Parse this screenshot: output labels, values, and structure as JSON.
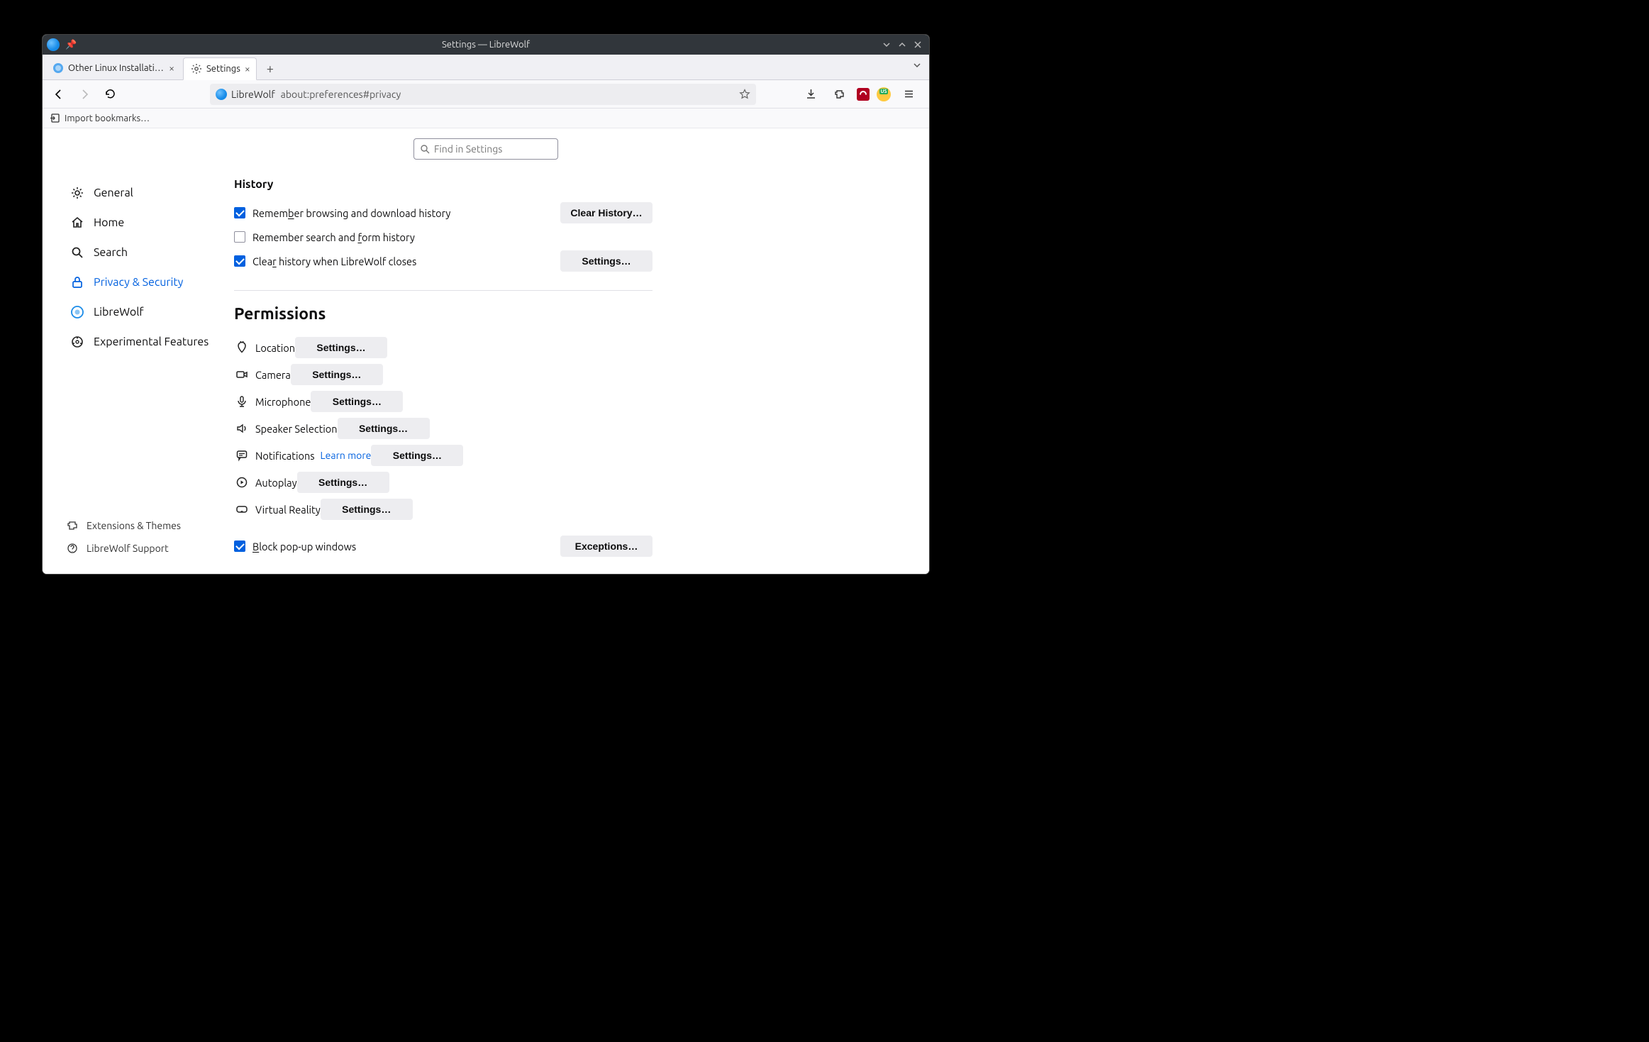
{
  "titlebar": {
    "title": "Settings — LibreWolf"
  },
  "tabs": [
    {
      "title": "Other Linux Installation – L"
    },
    {
      "title": "Settings"
    }
  ],
  "urlbar": {
    "brand": "LibreWolf",
    "url": "about:preferences#privacy"
  },
  "bookmarkbar": {
    "import": "Import bookmarks…"
  },
  "search": {
    "placeholder": "Find in Settings"
  },
  "categories": {
    "general": "General",
    "home": "Home",
    "search": "Search",
    "privacy": "Privacy & Security",
    "librewolf": "LibreWolf",
    "experimental": "Experimental Features"
  },
  "bottomlinks": {
    "extensions": "Extensions & Themes",
    "support": "LibreWolf Support"
  },
  "history": {
    "heading": "History",
    "remember_browsing_pre": "Remem",
    "remember_browsing_u": "b",
    "remember_browsing_post": "er browsing and download history",
    "remember_search_pre": "Remember search and ",
    "remember_search_u": "f",
    "remember_search_post": "orm history",
    "clear_close_pre": "Clea",
    "clear_close_u": "r",
    "clear_close_post": " history when LibreWolf closes",
    "clear_btn": "Clear History…",
    "settings_btn": "Settings…"
  },
  "permissions": {
    "heading": "Permissions",
    "location": "Location",
    "camera": "Camera",
    "microphone": "Microphone",
    "speaker": "Speaker Selection",
    "notifications": "Notifications",
    "learnmore": "Learn more",
    "autoplay": "Autoplay",
    "vr": "Virtual Reality",
    "settings_btn": "Settings…",
    "block_popups_pre": "",
    "block_popups_u": "B",
    "block_popups_post": "lock pop-up windows",
    "exceptions_btn": "Exceptions…"
  }
}
